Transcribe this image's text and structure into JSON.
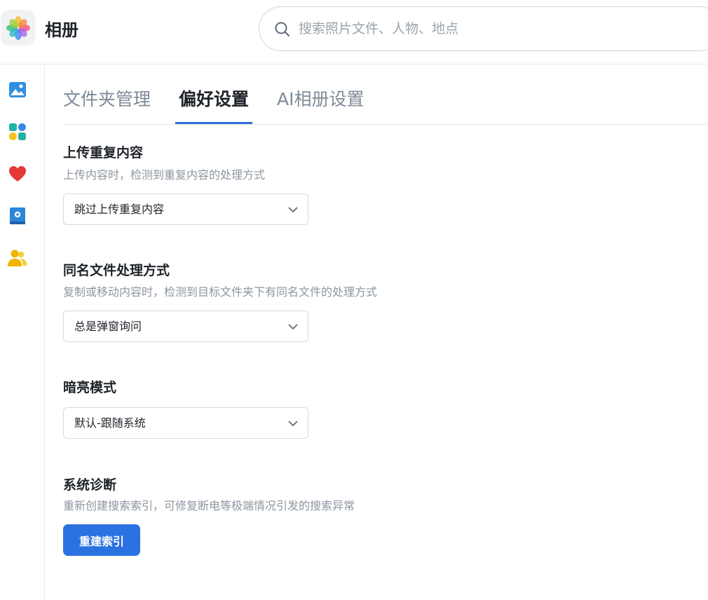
{
  "header": {
    "app_title": "相册",
    "search": {
      "placeholder": "搜索照片文件、人物、地点",
      "value": ""
    }
  },
  "sidebar": {
    "items": [
      {
        "name": "photos",
        "icon": "image-icon",
        "color": "#2f8fe0"
      },
      {
        "name": "albums",
        "icon": "albums-icon",
        "color": "#20b3a6"
      },
      {
        "name": "favorites",
        "icon": "heart-icon",
        "color": "#e53935"
      },
      {
        "name": "settings",
        "icon": "settings-book-icon",
        "color": "#2b86d9"
      },
      {
        "name": "people",
        "icon": "people-icon",
        "color": "#f0b400"
      }
    ]
  },
  "tabs": [
    {
      "label": "文件夹管理",
      "active": false
    },
    {
      "label": "偏好设置",
      "active": true
    },
    {
      "label": "AI相册设置",
      "active": false
    }
  ],
  "settings": {
    "upload_duplicate": {
      "title": "上传重复内容",
      "description": "上传内容时，检测到重复内容的处理方式",
      "selected": "跳过上传重复内容"
    },
    "same_name": {
      "title": "同名文件处理方式",
      "description": "复制或移动内容时，检测到目标文件夹下有同名文件的处理方式",
      "selected": "总是弹窗询问"
    },
    "dark_mode": {
      "title": "暗亮模式",
      "selected": "默认-跟随系统"
    },
    "diagnosis": {
      "title": "系统诊断",
      "description": "重新创建搜索索引，可修复断电等极端情况引发的搜索异常",
      "button_label": "重建索引"
    }
  },
  "colors": {
    "accent": "#2b72e1",
    "tab_underline": "#2f6fd6",
    "muted_text": "#8d96a0"
  }
}
